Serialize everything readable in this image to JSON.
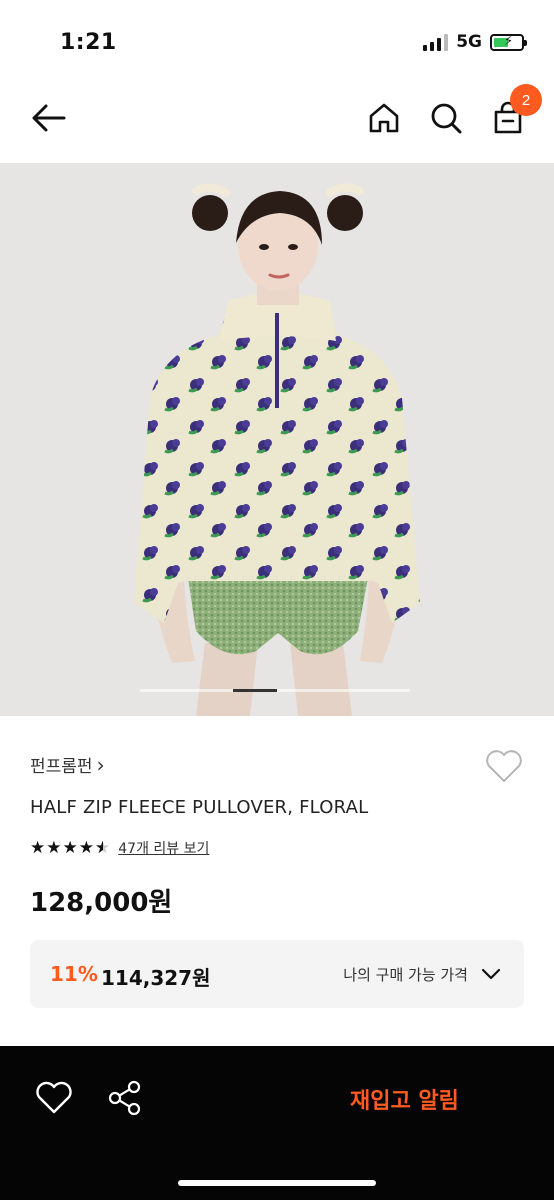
{
  "status_bar": {
    "time": "1:21",
    "network": "5G",
    "battery_color": "#34c759"
  },
  "nav": {
    "back_icon": "arrow-left-icon",
    "home_icon": "home-icon",
    "search_icon": "search-icon",
    "cart_icon": "shopping-bag-icon",
    "cart_count": "2",
    "badge_color": "#ff5a1f"
  },
  "hero": {
    "carousel_position": 0.35
  },
  "product": {
    "brand": "펀프롬펀",
    "brand_chevron": "›",
    "name": "HALF ZIP FLEECE PULLOVER, FLORAL",
    "rating_stars": 4.5,
    "review_link": "47개 리뷰 보기",
    "price": "128,000원"
  },
  "deal": {
    "discount": "11%",
    "price": "114,327원",
    "label": "나의 구매 가능 가격"
  },
  "bottom_bar": {
    "wishlist_icon": "heart-icon",
    "share_icon": "share-icon",
    "restock_label": "재입고 알림",
    "accent_color": "#ff5a1f"
  }
}
